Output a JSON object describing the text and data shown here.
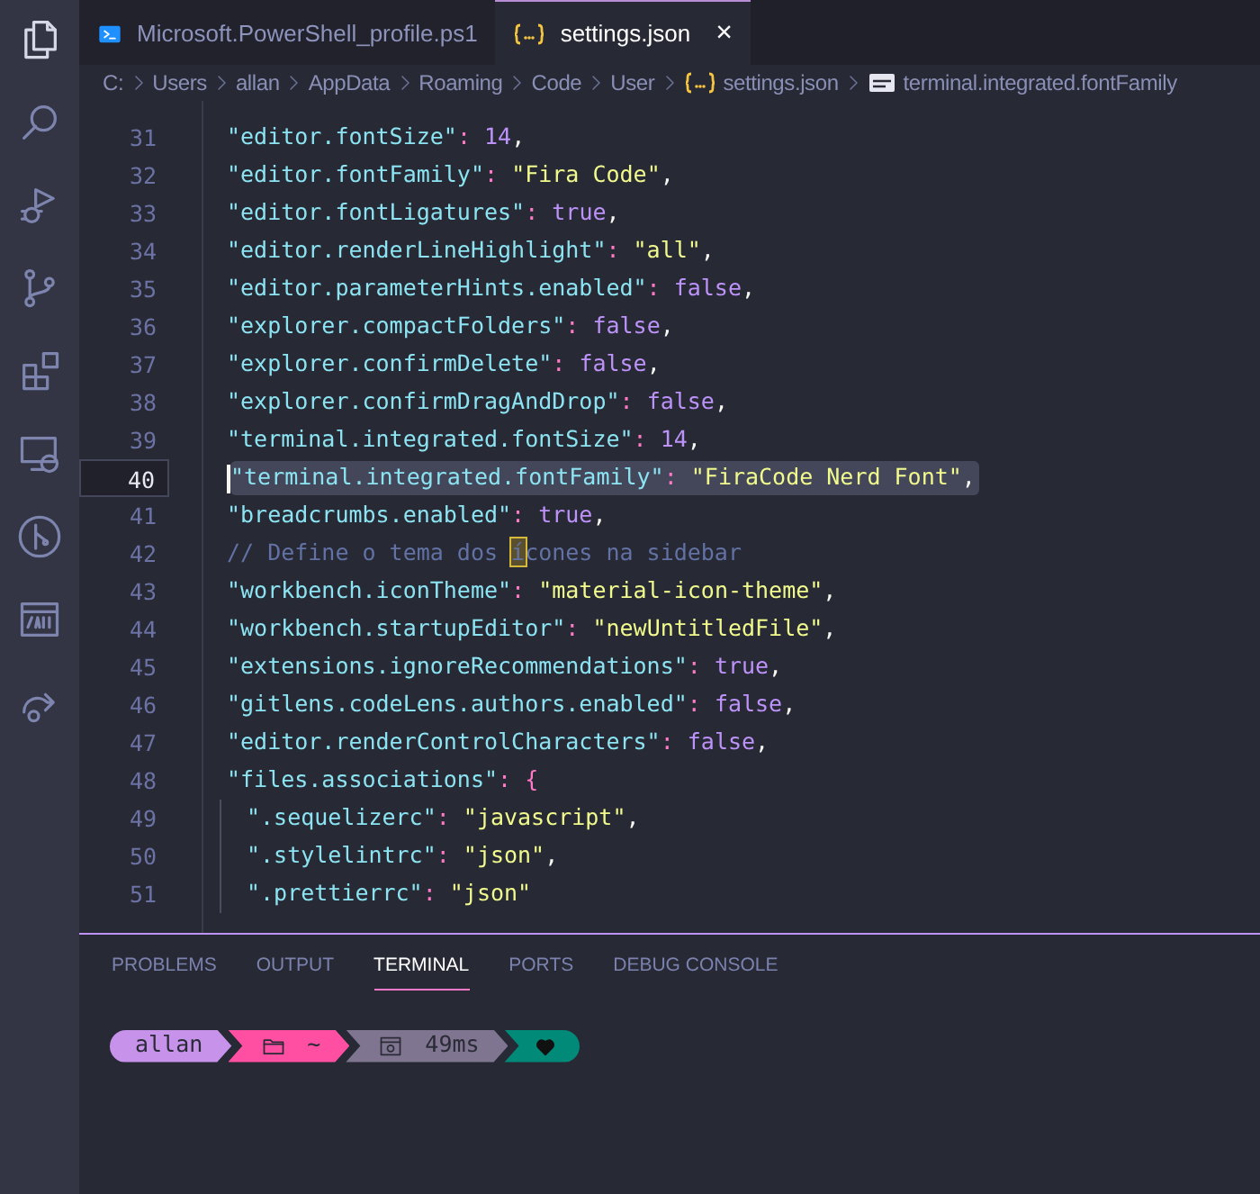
{
  "activity_bar": [
    {
      "kind": "files",
      "selected": true
    },
    {
      "kind": "search",
      "selected": false
    },
    {
      "kind": "debug",
      "selected": false
    },
    {
      "kind": "source-control",
      "selected": false
    },
    {
      "kind": "extensions",
      "selected": false
    },
    {
      "kind": "remote",
      "selected": false
    },
    {
      "kind": "git-graph",
      "selected": false
    },
    {
      "kind": "api",
      "selected": false
    },
    {
      "kind": "share",
      "selected": false
    }
  ],
  "tabs": [
    {
      "label": "Microsoft.PowerShell_profile.ps1",
      "kind": "powershell",
      "selected": false
    },
    {
      "label": "settings.json",
      "kind": "json",
      "selected": true,
      "close": "×"
    }
  ],
  "breadcrumbs": [
    {
      "label": "C:"
    },
    {
      "label": "Users"
    },
    {
      "label": "allan"
    },
    {
      "label": "AppData"
    },
    {
      "label": "Roaming"
    },
    {
      "label": "Code"
    },
    {
      "label": "User"
    },
    {
      "label": "settings.json",
      "kind": "json"
    },
    {
      "label": "terminal.integrated.fontFamily",
      "kind": "string"
    }
  ],
  "editor": {
    "lines": [
      {
        "number": "31",
        "current": false,
        "selected": false,
        "indent": false,
        "tokens": [
          {
            "kind": "key",
            "text": "\"editor.fontSize\""
          },
          {
            "kind": "punct",
            "text": ": "
          },
          {
            "kind": "literal",
            "text": "14"
          },
          {
            "kind": "comma",
            "text": ","
          }
        ]
      },
      {
        "number": "32",
        "current": false,
        "selected": false,
        "indent": false,
        "tokens": [
          {
            "kind": "key",
            "text": "\"editor.fontFamily\""
          },
          {
            "kind": "punct",
            "text": ": "
          },
          {
            "kind": "string",
            "text": "\"Fira Code\""
          },
          {
            "kind": "comma",
            "text": ","
          }
        ]
      },
      {
        "number": "33",
        "current": false,
        "selected": false,
        "indent": false,
        "tokens": [
          {
            "kind": "key",
            "text": "\"editor.fontLigatures\""
          },
          {
            "kind": "punct",
            "text": ": "
          },
          {
            "kind": "literal",
            "text": "true"
          },
          {
            "kind": "comma",
            "text": ","
          }
        ]
      },
      {
        "number": "34",
        "current": false,
        "selected": false,
        "indent": false,
        "tokens": [
          {
            "kind": "key",
            "text": "\"editor.renderLineHighlight\""
          },
          {
            "kind": "punct",
            "text": ": "
          },
          {
            "kind": "string",
            "text": "\"all\""
          },
          {
            "kind": "comma",
            "text": ","
          }
        ]
      },
      {
        "number": "35",
        "current": false,
        "selected": false,
        "indent": false,
        "tokens": [
          {
            "kind": "key",
            "text": "\"editor.parameterHints.enabled\""
          },
          {
            "kind": "punct",
            "text": ": "
          },
          {
            "kind": "literal",
            "text": "false"
          },
          {
            "kind": "comma",
            "text": ","
          }
        ]
      },
      {
        "number": "36",
        "current": false,
        "selected": false,
        "indent": false,
        "tokens": [
          {
            "kind": "key",
            "text": "\"explorer.compactFolders\""
          },
          {
            "kind": "punct",
            "text": ": "
          },
          {
            "kind": "literal",
            "text": "false"
          },
          {
            "kind": "comma",
            "text": ","
          }
        ]
      },
      {
        "number": "37",
        "current": false,
        "selected": false,
        "indent": false,
        "tokens": [
          {
            "kind": "key",
            "text": "\"explorer.confirmDelete\""
          },
          {
            "kind": "punct",
            "text": ": "
          },
          {
            "kind": "literal",
            "text": "false"
          },
          {
            "kind": "comma",
            "text": ","
          }
        ]
      },
      {
        "number": "38",
        "current": false,
        "selected": false,
        "indent": false,
        "tokens": [
          {
            "kind": "key",
            "text": "\"explorer.confirmDragAndDrop\""
          },
          {
            "kind": "punct",
            "text": ": "
          },
          {
            "kind": "literal",
            "text": "false"
          },
          {
            "kind": "comma",
            "text": ","
          }
        ]
      },
      {
        "number": "39",
        "current": false,
        "selected": false,
        "indent": false,
        "tokens": [
          {
            "kind": "key",
            "text": "\"terminal.integrated.fontSize\""
          },
          {
            "kind": "punct",
            "text": ": "
          },
          {
            "kind": "literal",
            "text": "14"
          },
          {
            "kind": "comma",
            "text": ","
          }
        ]
      },
      {
        "number": "40",
        "current": true,
        "selected": true,
        "indent": false,
        "tokens": [
          {
            "kind": "key",
            "text": "\"terminal.integrated.fontFamily\""
          },
          {
            "kind": "punct",
            "text": ": "
          },
          {
            "kind": "string",
            "text": "\"FiraCode Nerd Font\""
          },
          {
            "kind": "comma",
            "text": ","
          }
        ]
      },
      {
        "number": "41",
        "current": false,
        "selected": false,
        "indent": false,
        "tokens": [
          {
            "kind": "key",
            "text": "\"breadcrumbs.enabled\""
          },
          {
            "kind": "punct",
            "text": ": "
          },
          {
            "kind": "literal",
            "text": "true"
          },
          {
            "kind": "comma",
            "text": ","
          }
        ]
      },
      {
        "number": "42",
        "current": false,
        "selected": false,
        "indent": false,
        "tokens": [
          {
            "kind": "comment",
            "text": "// Define o tema dos "
          },
          {
            "kind": "marked",
            "text": "í"
          },
          {
            "kind": "comment",
            "text": "cones na sidebar"
          }
        ]
      },
      {
        "number": "43",
        "current": false,
        "selected": false,
        "indent": false,
        "tokens": [
          {
            "kind": "key",
            "text": "\"workbench.iconTheme\""
          },
          {
            "kind": "punct",
            "text": ": "
          },
          {
            "kind": "string",
            "text": "\"material-icon-theme\""
          },
          {
            "kind": "comma",
            "text": ","
          }
        ]
      },
      {
        "number": "44",
        "current": false,
        "selected": false,
        "indent": false,
        "tokens": [
          {
            "kind": "key",
            "text": "\"workbench.startupEditor\""
          },
          {
            "kind": "punct",
            "text": ": "
          },
          {
            "kind": "string",
            "text": "\"newUntitledFile\""
          },
          {
            "kind": "comma",
            "text": ","
          }
        ]
      },
      {
        "number": "45",
        "current": false,
        "selected": false,
        "indent": false,
        "tokens": [
          {
            "kind": "key",
            "text": "\"extensions.ignoreRecommendations\""
          },
          {
            "kind": "punct",
            "text": ": "
          },
          {
            "kind": "literal",
            "text": "true"
          },
          {
            "kind": "comma",
            "text": ","
          }
        ]
      },
      {
        "number": "46",
        "current": false,
        "selected": false,
        "indent": false,
        "tokens": [
          {
            "kind": "key",
            "text": "\"gitlens.codeLens.authors.enabled\""
          },
          {
            "kind": "punct",
            "text": ": "
          },
          {
            "kind": "literal",
            "text": "false"
          },
          {
            "kind": "comma",
            "text": ","
          }
        ]
      },
      {
        "number": "47",
        "current": false,
        "selected": false,
        "indent": false,
        "tokens": [
          {
            "kind": "key",
            "text": "\"editor.renderControlCharacters\""
          },
          {
            "kind": "punct",
            "text": ": "
          },
          {
            "kind": "literal",
            "text": "false"
          },
          {
            "kind": "comma",
            "text": ","
          }
        ]
      },
      {
        "number": "48",
        "current": false,
        "selected": false,
        "indent": false,
        "tokens": [
          {
            "kind": "key",
            "text": "\"files.associations\""
          },
          {
            "kind": "punct",
            "text": ": "
          },
          {
            "kind": "brace",
            "text": "{"
          }
        ]
      },
      {
        "number": "49",
        "current": false,
        "selected": false,
        "indent": true,
        "tokens": [
          {
            "kind": "key",
            "text": "\".sequelizerc\""
          },
          {
            "kind": "punct",
            "text": ": "
          },
          {
            "kind": "string",
            "text": "\"javascript\""
          },
          {
            "kind": "comma",
            "text": ","
          }
        ]
      },
      {
        "number": "50",
        "current": false,
        "selected": false,
        "indent": true,
        "tokens": [
          {
            "kind": "key",
            "text": "\".stylelintrc\""
          },
          {
            "kind": "punct",
            "text": ": "
          },
          {
            "kind": "string",
            "text": "\"json\""
          },
          {
            "kind": "comma",
            "text": ","
          }
        ]
      },
      {
        "number": "51",
        "current": false,
        "selected": false,
        "indent": true,
        "tokens": [
          {
            "kind": "key",
            "text": "\".prettierrc\""
          },
          {
            "kind": "punct",
            "text": ": "
          },
          {
            "kind": "string",
            "text": "\"json\""
          }
        ]
      }
    ]
  },
  "panel": {
    "tabs": [
      {
        "label": "PROBLEMS",
        "selected": false
      },
      {
        "label": "OUTPUT",
        "selected": false
      },
      {
        "label": "TERMINAL",
        "selected": true
      },
      {
        "label": "PORTS",
        "selected": false
      },
      {
        "label": "DEBUG CONSOLE",
        "selected": false
      }
    ],
    "prompt": [
      {
        "kind": "user",
        "text": "allan",
        "color": "#c792ea"
      },
      {
        "kind": "folder",
        "text": "~",
        "color": "#ff4fa2"
      },
      {
        "kind": "timer",
        "text": "49ms",
        "color": "#7f7590"
      },
      {
        "kind": "status",
        "color": "#008a77"
      }
    ]
  }
}
